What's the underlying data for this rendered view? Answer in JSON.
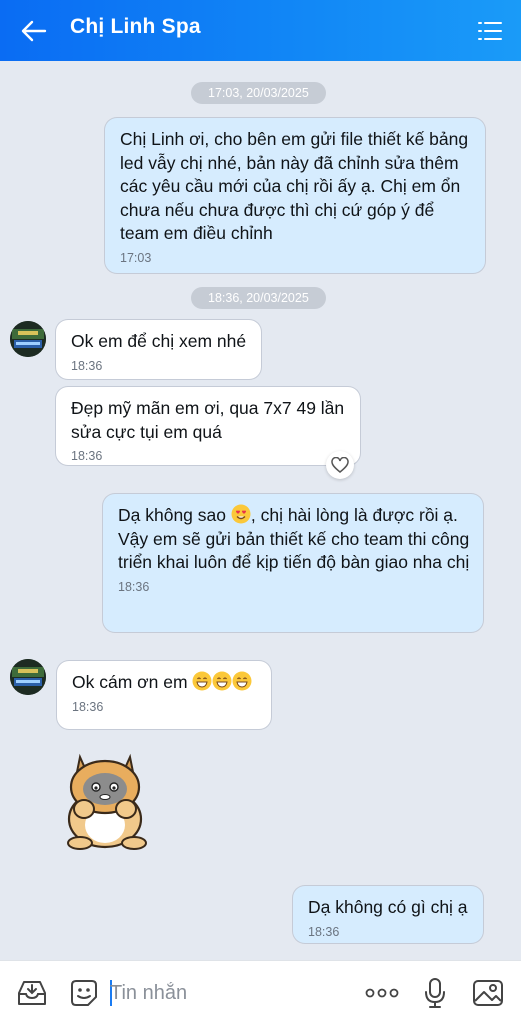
{
  "header": {
    "title": "Chị Linh Spa",
    "back_icon": "arrow-left-icon",
    "menu_icon": "list-menu-icon",
    "bg_color": "#0a6cf3"
  },
  "timestamps": [
    "17:03, 20/03/2025",
    "18:36, 20/03/2025"
  ],
  "messages": [
    {
      "from": "me",
      "text": "Chị Linh ơi, cho bên em gửi file thiết kế bảng led vẫy chị nhé, bản này đã chỉnh sửa thêm các yêu cầu mới của chị rồi ấy ạ. Chị em ổn chưa nếu chưa được thì chị cứ góp ý để team em điều chỉnh",
      "time": "17:03"
    },
    {
      "from": "them",
      "text": "Ok em để chị xem nhé",
      "time": "18:36"
    },
    {
      "from": "them",
      "text": "Đẹp mỹ mãn em ơi, qua 7x7 49 lần sửa cực tụi em quá",
      "time": "18:36",
      "reaction_icon": "heart-outline-icon"
    },
    {
      "from": "me",
      "text_before_emoji": "Dạ không sao ",
      "emoji": "heart-eyes-emoji",
      "text_after_emoji": ", chị hài lòng là được rồi ạ. Vậy em sẽ gửi bản thiết kế cho team thi công triển khai luôn để kịp tiến độ bàn giao nha chị",
      "time": "18:36"
    },
    {
      "from": "them",
      "text": "Ok cám ơn em ",
      "emojis": [
        "grinning-emoji",
        "grinning-emoji",
        "grinning-emoji"
      ],
      "time": "18:36"
    },
    {
      "from": "them",
      "type": "sticker",
      "sticker": "cat-sticker"
    },
    {
      "from": "me",
      "text": "Dạ không có gì chị ạ",
      "time": "18:36"
    }
  ],
  "composer": {
    "placeholder": "Tin nhắn",
    "icons": [
      "inbox-icon",
      "sticker-icon",
      "more-icon",
      "microphone-icon",
      "image-icon"
    ]
  },
  "colors": {
    "my_bubble": "#d6ecfe",
    "their_bubble": "#ffffff",
    "background": "#e4e9f1"
  }
}
